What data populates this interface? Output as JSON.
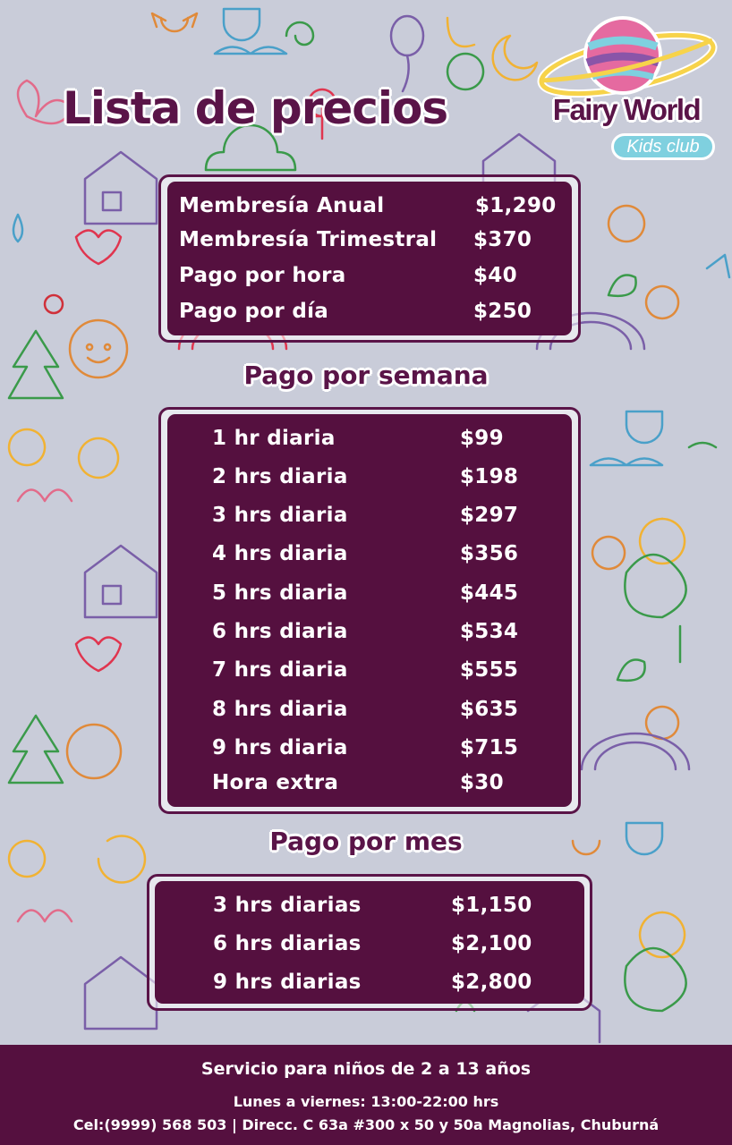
{
  "header": {
    "title": "Lista de precios"
  },
  "logo": {
    "name": "Fairy World",
    "subtitle": "Kids club"
  },
  "general_prices": [
    {
      "label": "Membresía Anual",
      "price": "$1,290"
    },
    {
      "label": "Membresía Trimestral",
      "price": "$370"
    },
    {
      "label": "Pago por hora",
      "price": "$40"
    },
    {
      "label": "Pago por día",
      "price": "$250"
    }
  ],
  "weekly": {
    "title": "Pago por semana",
    "rows": [
      {
        "label": "1 hr diaria",
        "price": "$99"
      },
      {
        "label": "2 hrs diaria",
        "price": "$198"
      },
      {
        "label": "3 hrs diaria",
        "price": "$297"
      },
      {
        "label": "4 hrs diaria",
        "price": "$356"
      },
      {
        "label": "5 hrs diaria",
        "price": "$445"
      },
      {
        "label": "6 hrs diaria",
        "price": "$534"
      },
      {
        "label": "7 hrs diaria",
        "price": "$555"
      },
      {
        "label": "8 hrs diaria",
        "price": "$635"
      },
      {
        "label": "9 hrs diaria",
        "price": "$715"
      },
      {
        "label": "Hora extra",
        "price": "$30"
      }
    ]
  },
  "monthly": {
    "title": "Pago por mes",
    "rows": [
      {
        "label": "3 hrs diarias",
        "price": "$1,150"
      },
      {
        "label": "6 hrs diarias",
        "price": "$2,100"
      },
      {
        "label": "9 hrs diarias",
        "price": "$2,800"
      }
    ]
  },
  "footer": {
    "service": "Servicio para niños de 2 a 13 años",
    "hours": "Lunes a viernes: 13:00-22:00 hrs",
    "contact": "Cel:(9999) 568 503  |  Direcc. C 63a #300 x 50 y 50a Magnolias, Chuburná"
  },
  "colors": {
    "primary": "#55103f",
    "background": "#c9ccd9",
    "accent": "#7fd0df"
  }
}
